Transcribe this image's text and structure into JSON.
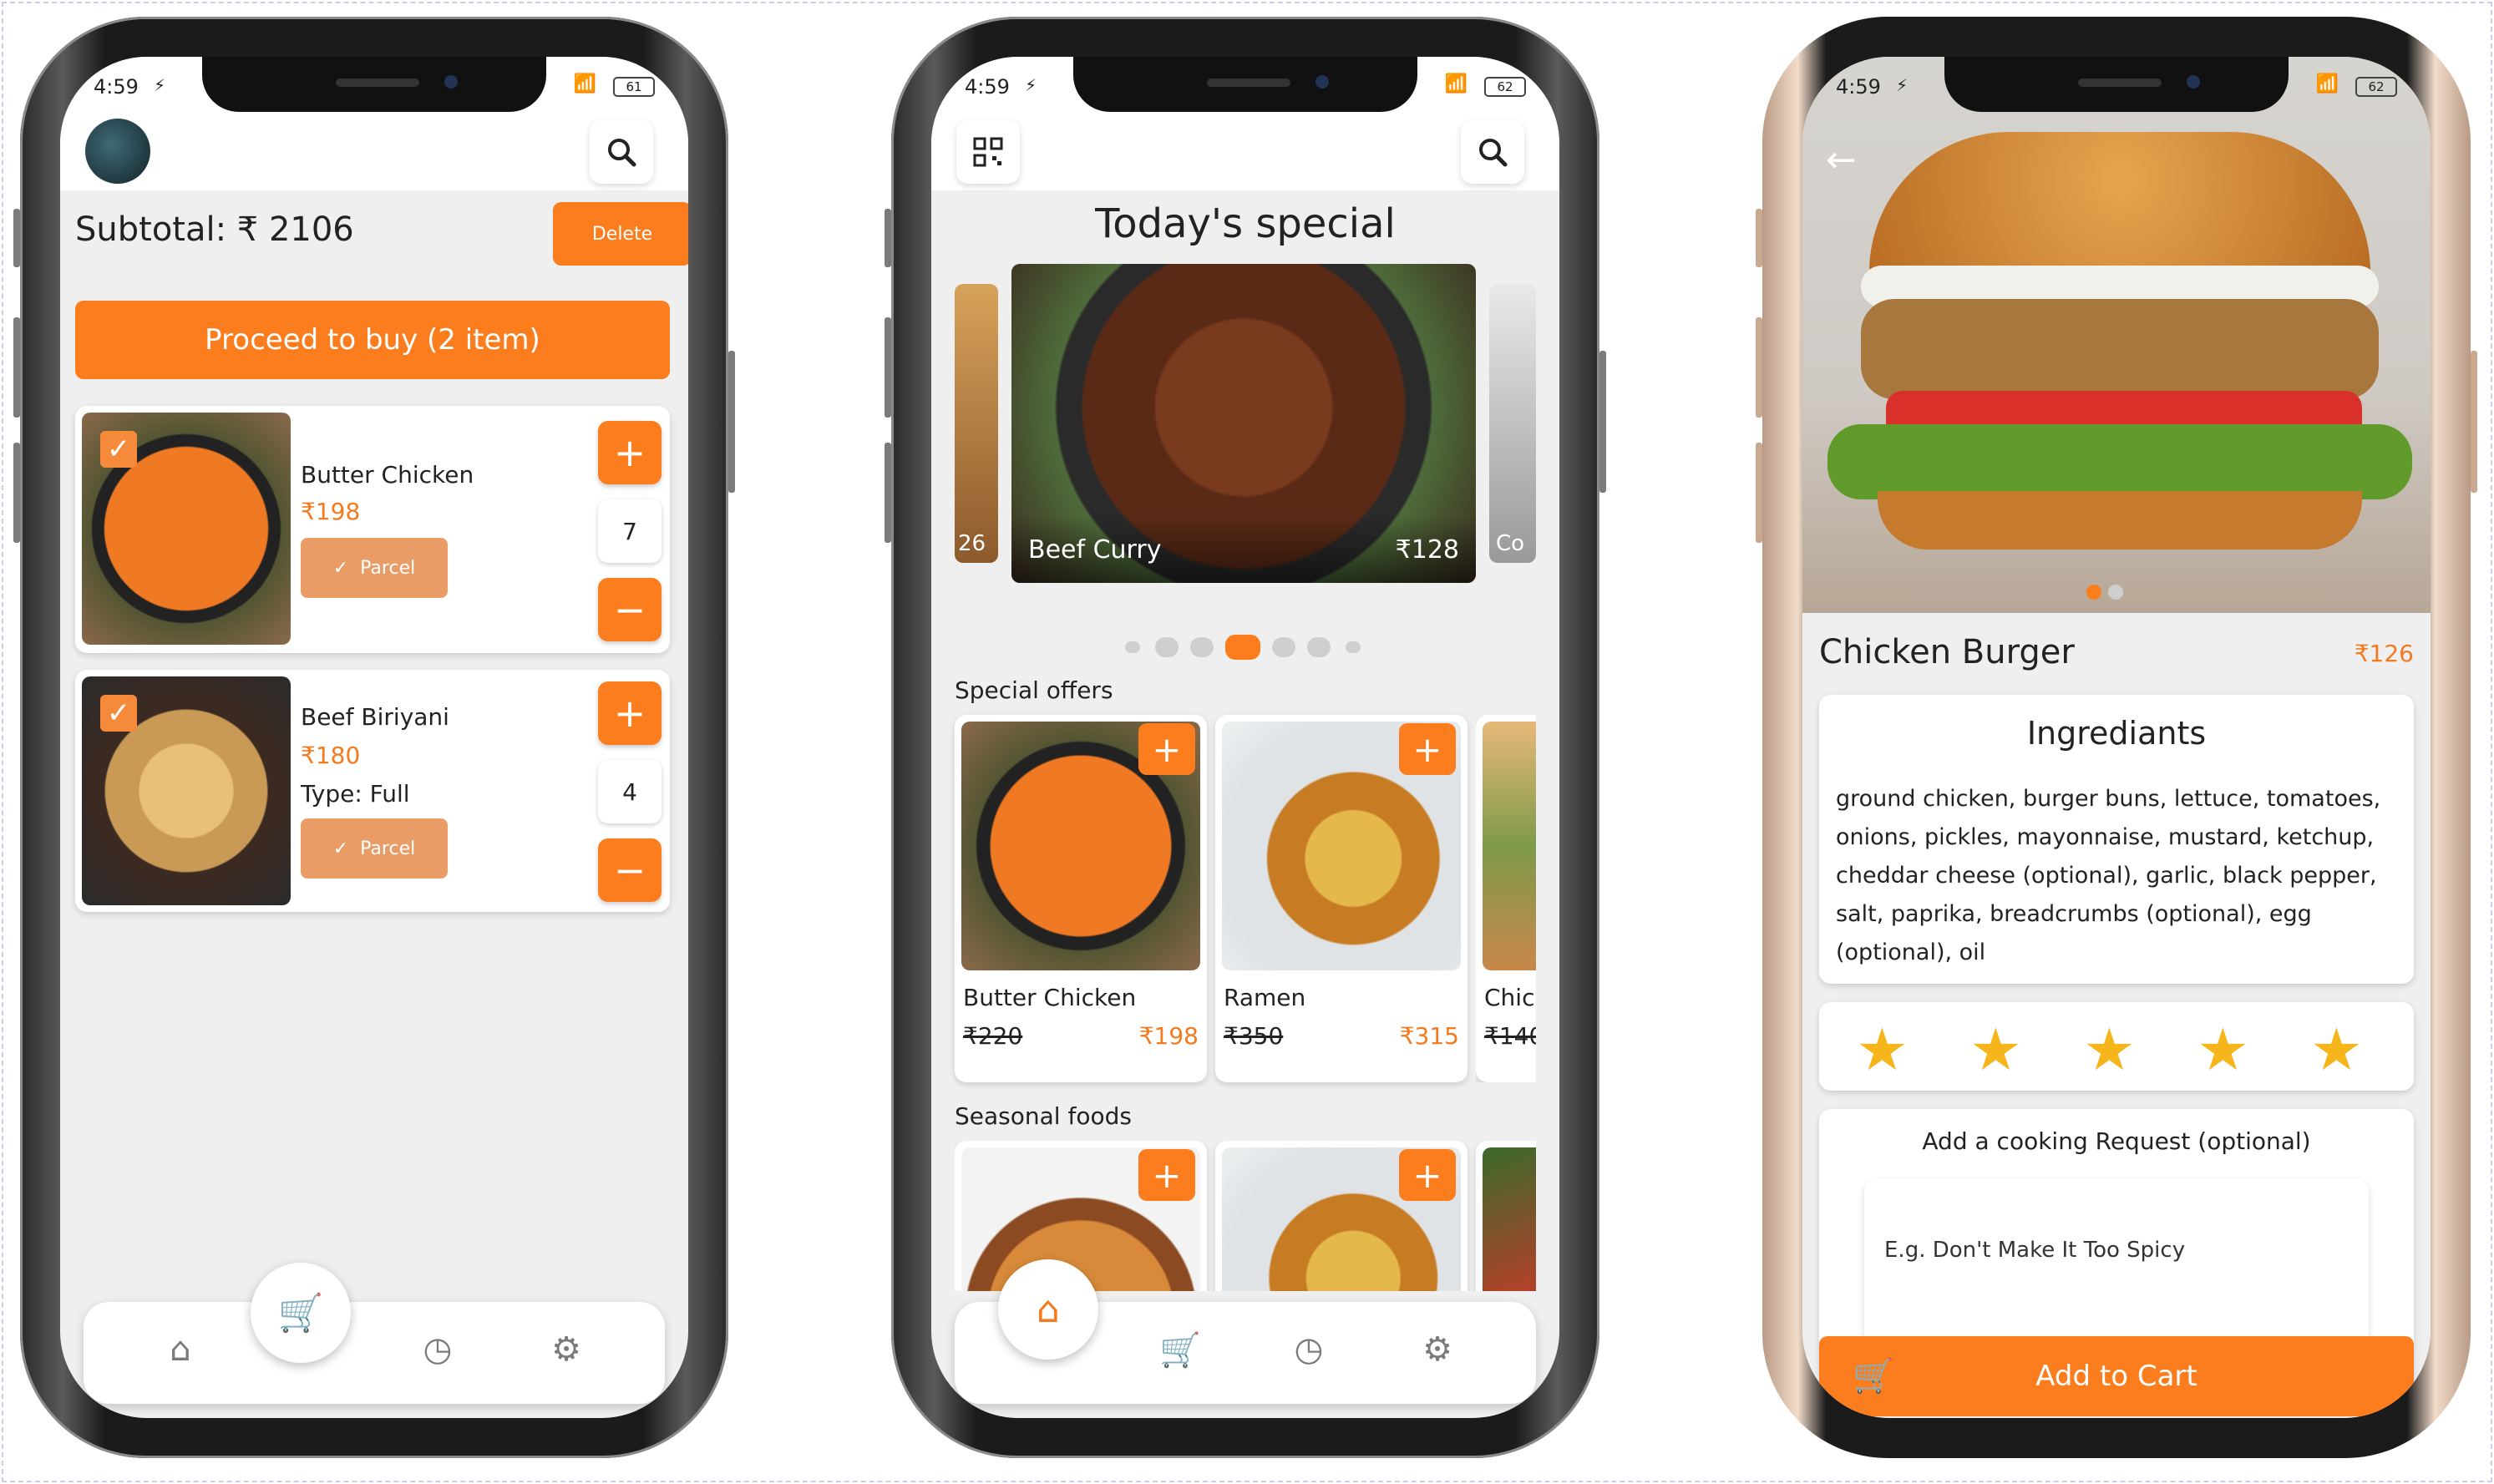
{
  "status": {
    "time": "4:59",
    "wifi": "WiFi",
    "battery_1": "61",
    "battery_2": "62",
    "battery_3": "62"
  },
  "cart": {
    "subtotal": "Subtotal: ₹ 2106",
    "delete_label": "Delete",
    "proceed_label": "Proceed to buy (2 item)",
    "items": [
      {
        "name": "Butter Chicken",
        "price": "₹198",
        "qty": "7",
        "parcel": "Parcel",
        "type": ""
      },
      {
        "name": "Beef Biriyani",
        "price": "₹180",
        "qty": "4",
        "parcel": "Parcel",
        "type": "Type: Full"
      }
    ]
  },
  "home": {
    "heading": "Today's special",
    "carousel": {
      "left_peek": "26",
      "main_name": "Beef Curry",
      "main_price": "₹128",
      "right_peek": "Co"
    },
    "special_offers_title": "Special offers",
    "special_offers": [
      {
        "name": "Butter Chicken",
        "old_price": "₹220",
        "price": "₹198"
      },
      {
        "name": "Ramen",
        "old_price": "₹350",
        "price": "₹315"
      },
      {
        "name": "Chic",
        "old_price": "₹140",
        "price": ""
      }
    ],
    "seasonal_title": "Seasonal foods"
  },
  "detail": {
    "name": "Chicken Burger",
    "price": "₹126",
    "ingredients_title": "Ingrediants",
    "ingredients_text": "ground chicken, burger buns, lettuce, tomatoes, onions, pickles, mayonnaise, mustard, ketchup, cheddar cheese (optional), garlic, black pepper, salt, paprika, breadcrumbs (optional), egg (optional), oil",
    "rating": 5,
    "request_title": "Add a cooking Request (optional)",
    "request_placeholder": "E.g. Don't Make It Too Spicy",
    "add_to_cart_label": "Add to Cart"
  },
  "colors": {
    "accent": "#fb7d1d",
    "parcel": "#ea9c66",
    "star": "#f5b51b"
  },
  "icons": [
    "search-icon",
    "qr-scan-icon",
    "home-icon",
    "cart-icon",
    "history-icon",
    "settings-icon",
    "back-arrow-icon",
    "check-icon",
    "plus-icon",
    "minus-icon",
    "star-icon"
  ]
}
